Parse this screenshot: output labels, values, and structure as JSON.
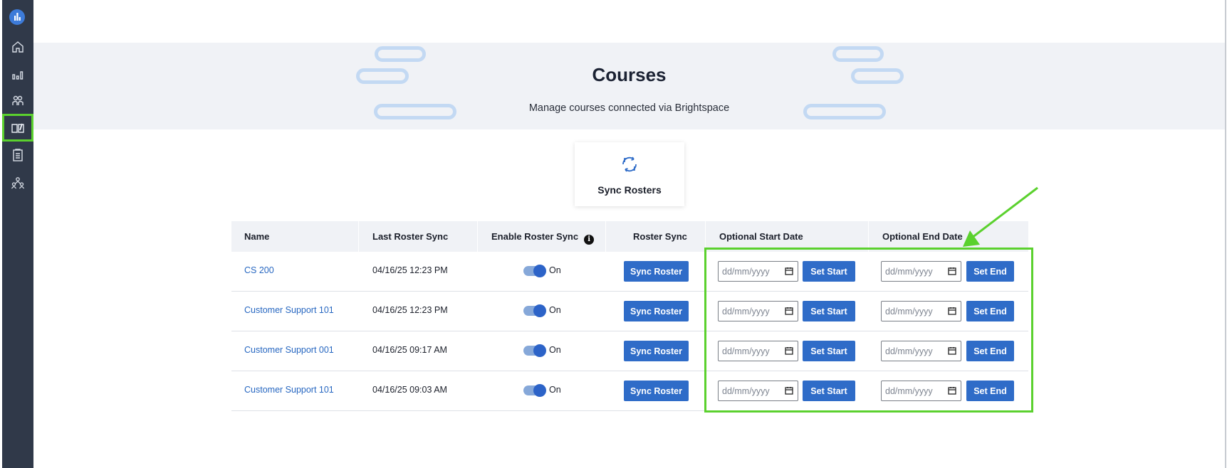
{
  "sidebar": {
    "logo": "brand-logo",
    "items": [
      {
        "icon": "home-icon"
      },
      {
        "icon": "bar-chart-icon"
      },
      {
        "icon": "users-icon"
      },
      {
        "icon": "book-icon",
        "active": true
      },
      {
        "icon": "clipboard-icon"
      },
      {
        "icon": "team-icon"
      }
    ]
  },
  "header": {
    "title": "Courses",
    "subtitle": "Manage courses connected via Brightspace"
  },
  "sync_card": {
    "label": "Sync Rosters",
    "icon": "sync-icon"
  },
  "table": {
    "columns": [
      "Name",
      "Last Roster Sync",
      "Enable Roster Sync",
      "Roster Sync",
      "Optional Start Date",
      "Optional End Date"
    ],
    "rows": [
      {
        "name": "CS 200",
        "last_sync": "04/16/25 12:23 PM",
        "enabled": "On",
        "sync_label": "Sync Roster",
        "start_placeholder": "dd/mm/yyyy",
        "start_btn": "Set Start",
        "end_placeholder": "dd/mm/yyyy",
        "end_btn": "Set End"
      },
      {
        "name": "Customer Support 101",
        "last_sync": "04/16/25 12:23 PM",
        "enabled": "On",
        "sync_label": "Sync Roster",
        "start_placeholder": "dd/mm/yyyy",
        "start_btn": "Set Start",
        "end_placeholder": "dd/mm/yyyy",
        "end_btn": "Set End"
      },
      {
        "name": "Customer Support 001",
        "last_sync": "04/16/25 09:17 AM",
        "enabled": "On",
        "sync_label": "Sync Roster",
        "start_placeholder": "dd/mm/yyyy",
        "start_btn": "Set Start",
        "end_placeholder": "dd/mm/yyyy",
        "end_btn": "Set End"
      },
      {
        "name": "Customer Support 101",
        "last_sync": "04/16/25 09:03 AM",
        "enabled": "On",
        "sync_label": "Sync Roster",
        "start_placeholder": "dd/mm/yyyy",
        "start_btn": "Set Start",
        "end_placeholder": "dd/mm/yyyy",
        "end_btn": "Set End"
      }
    ]
  },
  "colors": {
    "sidebar": "#303949",
    "accent": "#2f6cc8",
    "link": "#2767c1",
    "highlight": "#5bd12e"
  }
}
